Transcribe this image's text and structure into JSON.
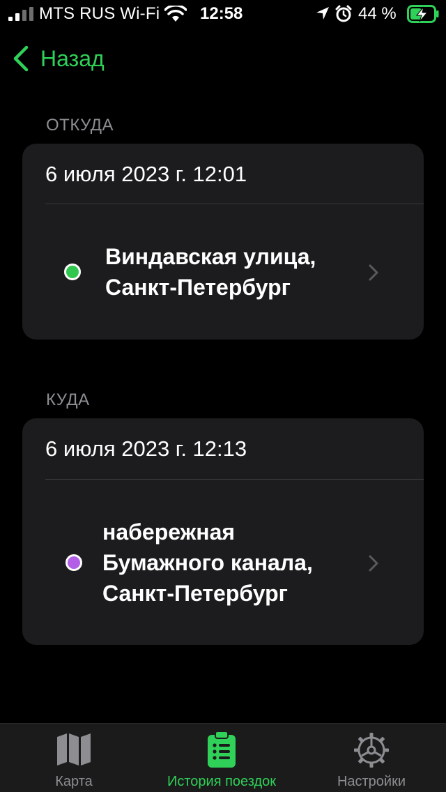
{
  "status_bar": {
    "carrier": "MTS RUS Wi-Fi",
    "time": "12:58",
    "battery_percent": "44 %"
  },
  "nav": {
    "back_label": "Назад"
  },
  "from": {
    "section_title": "ОТКУДА",
    "date": "6 июля 2023 г.  12:01",
    "address_lines": [
      "Виндавская улица,",
      "Санкт-Петербург"
    ],
    "dot_color": "#30c74f"
  },
  "to": {
    "section_title": "КУДА",
    "date": "6 июля 2023 г.  12:13",
    "address_lines": [
      "набережная",
      "Бумажного канала,",
      "Санкт-Петербург"
    ],
    "dot_color": "#b25ee6"
  },
  "tabs": [
    {
      "label": "Карта",
      "icon": "map-icon",
      "active": false
    },
    {
      "label": "История поездок",
      "icon": "clipboard-list-icon",
      "active": true
    },
    {
      "label": "Настройки",
      "icon": "gear-icon",
      "active": false
    }
  ],
  "colors": {
    "accent": "#2fd159",
    "inactive": "#8d8d92",
    "card_bg": "#1c1c1e"
  }
}
